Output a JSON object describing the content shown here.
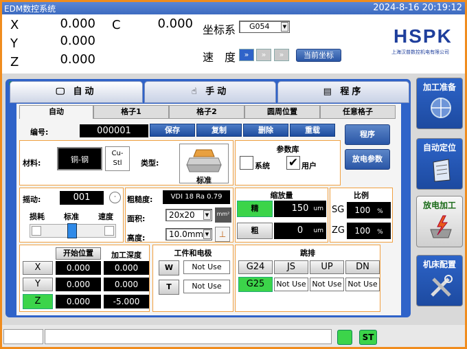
{
  "title": "EDM数控系统",
  "datetime": "2024-8-16 20:19:12",
  "axes": [
    {
      "label": "X",
      "value": "0.000"
    },
    {
      "label": "Y",
      "value": "0.000"
    },
    {
      "label": "Z",
      "value": "0.000"
    }
  ],
  "axis_c": {
    "label": "C",
    "value": "0.000"
  },
  "coord": {
    "label": "坐标系",
    "value": "G054"
  },
  "speed": {
    "label": "速　度",
    "current_button": "当前坐标"
  },
  "logo": {
    "text": "HSPK",
    "subtitle": "上海汉普数控机电有限公司"
  },
  "main_tabs": [
    {
      "label": "自动",
      "icon": "monitor-icon"
    },
    {
      "label": "手动",
      "icon": "hand-icon"
    },
    {
      "label": "程序",
      "icon": "document-icon"
    }
  ],
  "sub_tabs": [
    "自动",
    "格子1",
    "格子2",
    "圆周位置",
    "任意格子"
  ],
  "number": {
    "label": "编号:",
    "value": "000001"
  },
  "actions": [
    "保存",
    "复制",
    "删除",
    "重载"
  ],
  "side_actions": [
    "程序",
    "放电参数"
  ],
  "material": {
    "label": "材料:",
    "value": "铜-钢",
    "option": "Cu-\nStl",
    "type_label": "类型:",
    "type_value": "标准"
  },
  "param_lib": {
    "title": "参数库",
    "system": "系统",
    "user": "用户"
  },
  "shake": {
    "label": "摇动:",
    "value": "001"
  },
  "slider": {
    "left": "损耗",
    "mid": "标准",
    "right": "速度"
  },
  "rough": {
    "label": "粗糙度:",
    "value": "VDI 18   Ra 0.79"
  },
  "area": {
    "label": "面积:",
    "value": "20x20",
    "unit": "mm²"
  },
  "height": {
    "label": "高度:",
    "value": "10.0mm"
  },
  "shrink": {
    "title": "缩放量",
    "fine_label": "精",
    "fine_value": "150",
    "coarse_label": "粗",
    "coarse_value": "0",
    "unit": "um"
  },
  "ratio": {
    "title": "比例",
    "sg_label": "SG",
    "sg_value": "100",
    "zg_label": "ZG",
    "zg_value": "100",
    "unit": "%"
  },
  "positions": {
    "start_label": "开始位置",
    "depth_label": "加工深度",
    "rows": [
      {
        "axis": "X",
        "start": "0.000",
        "depth": "0.000"
      },
      {
        "axis": "Y",
        "start": "0.000",
        "depth": "0.000"
      },
      {
        "axis": "Z",
        "start": "0.000",
        "depth": "-5.000"
      }
    ]
  },
  "workpiece": {
    "title": "工件和电极",
    "w_label": "W",
    "w_value": "Not Use",
    "t_label": "T",
    "t_value": "Not Use"
  },
  "jump": {
    "title": "跳排",
    "top": [
      "G24",
      "JS",
      "UP",
      "DN"
    ],
    "g25": "G25",
    "bottom": [
      "Not Use",
      "Not Use",
      "Not Use"
    ]
  },
  "side_buttons": [
    {
      "label": "加工准备",
      "icon": "target-icon"
    },
    {
      "label": "自动定位",
      "icon": "clipboard-icon"
    },
    {
      "label": "放电加工",
      "icon": "spark-icon"
    },
    {
      "label": "机床配置",
      "icon": "tools-icon"
    }
  ],
  "status": {
    "st_label": "ST"
  },
  "colors": {
    "accent": "#2f63c9",
    "frame": "#f08c1e",
    "active_green": "#3cd44a"
  }
}
